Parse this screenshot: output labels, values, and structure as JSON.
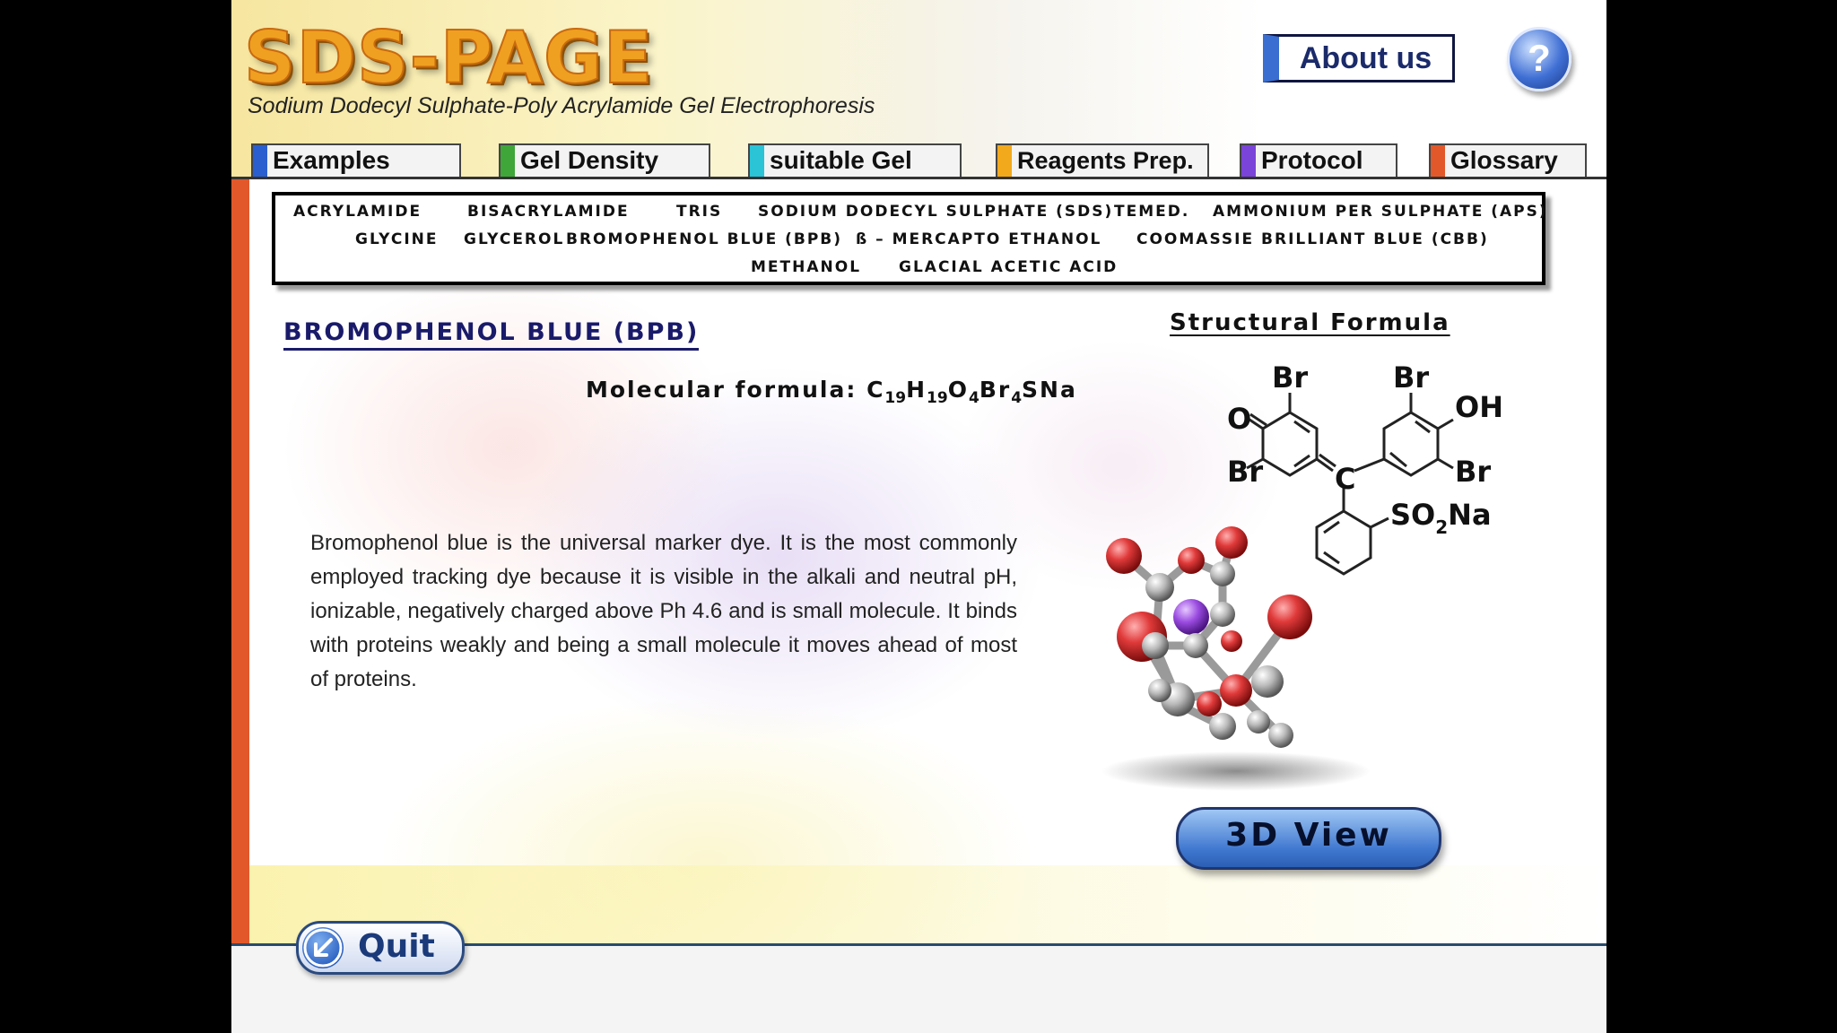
{
  "header": {
    "title": "SDS-PAGE",
    "subtitle": "Sodium Dodecyl Sulphate-Poly Acrylamide Gel Electrophoresis",
    "about_label": "About us",
    "help_label": "?"
  },
  "tabs": [
    {
      "label": "Examples",
      "color": "#2a5fd0"
    },
    {
      "label": "Gel Density",
      "color": "#3fa63a"
    },
    {
      "label": "suitable Gel",
      "color": "#2ac4d6"
    },
    {
      "label": "Reagents Prep.",
      "color": "#f2a91c"
    },
    {
      "label": "Protocol",
      "color": "#7a44d8"
    },
    {
      "label": "Glossary",
      "color": "#e2582a"
    }
  ],
  "chemicals": {
    "row1": [
      "ACRYLAMIDE",
      "BISACRYLAMIDE",
      "TRIS",
      "SODIUM DODECYL SULPHATE (SDS)",
      "TEMED.",
      "AMMONIUM PER SULPHATE (APS)"
    ],
    "row2": [
      "GLYCINE",
      "GLYCEROL",
      "BROMOPHENOL BLUE (BPB)",
      "ß – MERCAPTO ETHANOL",
      "COOMASSIE BRILLIANT BLUE (CBB)"
    ],
    "row3": [
      "METHANOL",
      "GLACIAL ACETIC ACID"
    ]
  },
  "content": {
    "heading": "BROMOPHENOL BLUE (BPB)",
    "formula_label": "Molecular formula:",
    "formula_parts": [
      "C",
      "19",
      "H",
      "19",
      "O",
      "4",
      "Br",
      "4",
      "SNa"
    ],
    "description": "Bromophenol blue is the universal marker dye. It is the most commonly employed tracking dye because it is visible in the alkali and neutral pH, ionizable, negatively charged above Ph 4.6 and is small molecule. It binds with proteins weakly and being a small molecule it moves ahead of most of proteins."
  },
  "structure": {
    "title": "Structural Formula",
    "labels": {
      "o": "O",
      "br": "Br",
      "oh": "OH",
      "c": "C",
      "so": "SO",
      "so_sub": "2",
      "na": "Na"
    }
  },
  "buttons": {
    "view3d_label": "3D View",
    "quit_label": "Quit"
  },
  "colors": {
    "accent_orange": "#e2582a",
    "title_orange": "#f0a020",
    "heading_blue": "#1a1a6a",
    "button_blue": "#3f77cf"
  }
}
